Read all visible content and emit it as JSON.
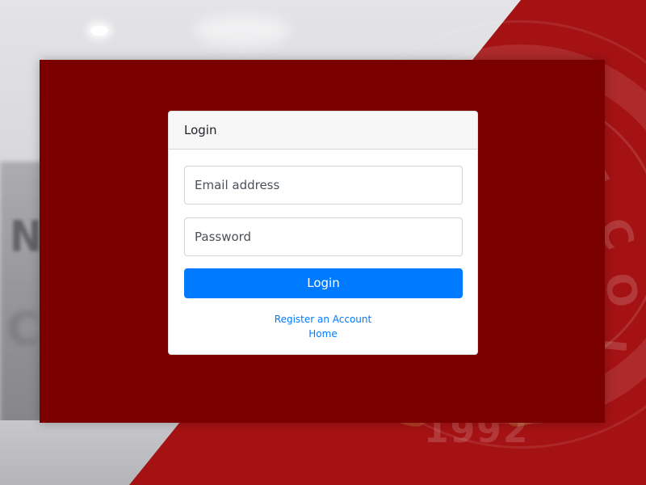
{
  "card": {
    "header": "Login",
    "email_placeholder": "Email address",
    "password_placeholder": "Password",
    "login_button": "Login",
    "register_link": "Register an Account",
    "home_link": "Home"
  },
  "background": {
    "seal_year": "1992"
  },
  "colors": {
    "panel": "#7a0000",
    "brand_red": "#a51214",
    "primary": "#007bff",
    "card_header_bg": "#f7f7f7"
  }
}
